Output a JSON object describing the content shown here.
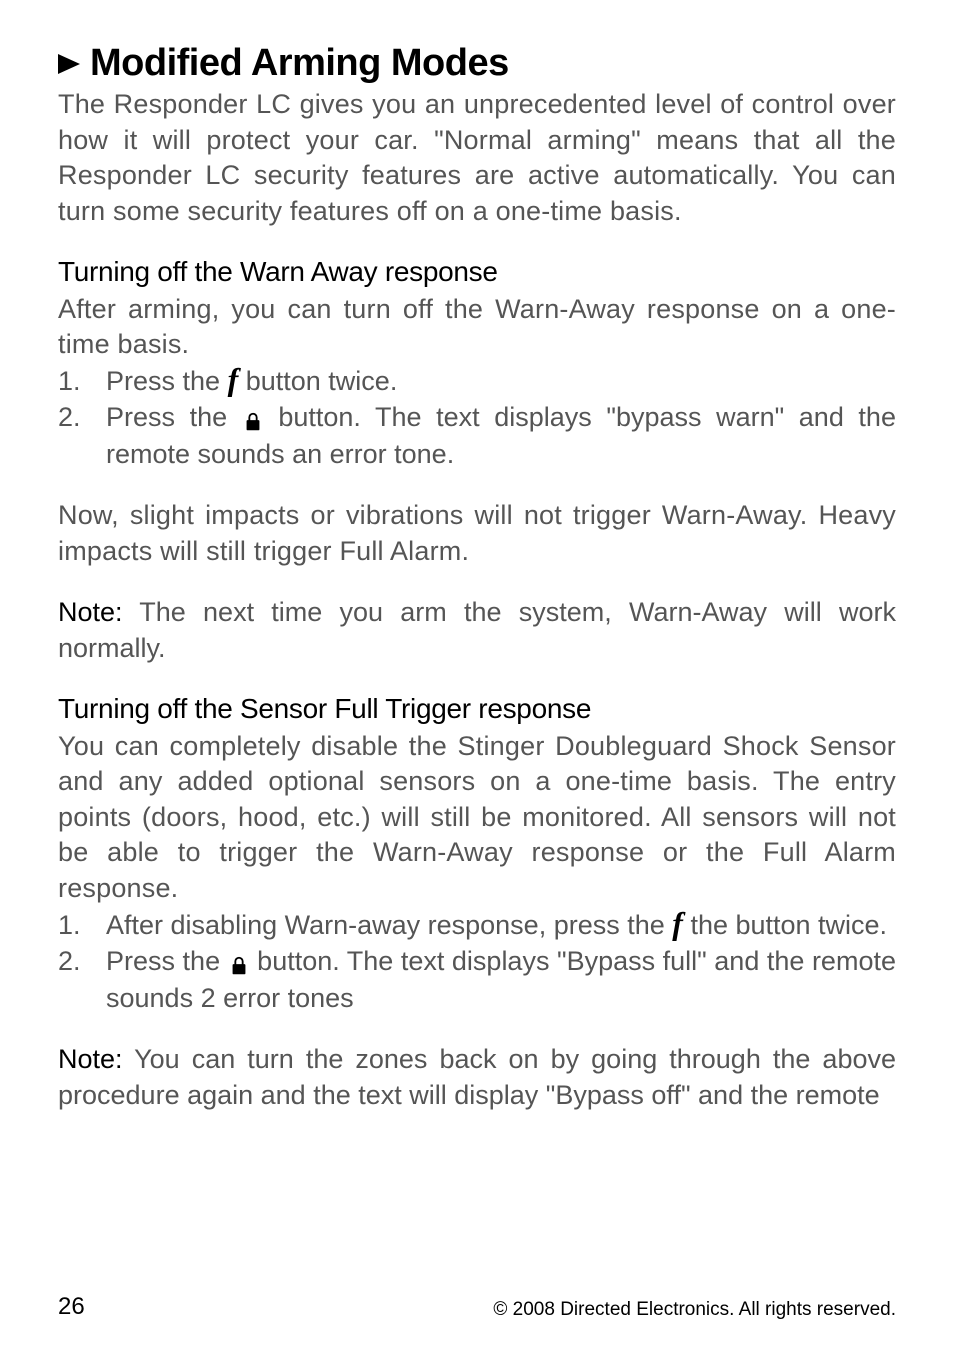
{
  "heading": "Modified Arming Modes",
  "intro": "The Responder LC gives you an unprecedented level of control over how it will protect your car. \"Normal arming\" means that all the Responder LC security features are active automatically. You can turn some security features off on a one-time basis.",
  "s1": {
    "title": "Turning off the Warn Away response",
    "lead": "After arming, you can turn off the Warn-Away response on a one-time basis.",
    "li1_num": "1.",
    "li1_a": "Press the ",
    "li1_b": " button twice.",
    "li2_num": "2.",
    "li2_a": "Press the ",
    "li2_b": " button. The text displays \"bypass warn\" and the remote sounds an error tone.",
    "after": "Now, slight impacts or vibrations will not trigger Warn-Away. Heavy impacts will still trigger Full Alarm.",
    "note_label": "Note:",
    "note": " The next time you arm the system, Warn-Away will work normally."
  },
  "s2": {
    "title": "Turning off the Sensor Full Trigger response",
    "lead": "You can completely disable the Stinger Doubleguard Shock Sensor and any added optional sensors on a one-time basis. The entry points (doors, hood, etc.) will still be monitored. All sensors will not be able to trigger the Warn-Away response or the Full Alarm response.",
    "li1_num": "1.",
    "li1_a": "After disabling Warn-away response, press the ",
    "li1_b": " the button twice.",
    "li2_num": "2.",
    "li2_a": "Press the ",
    "li2_b": " button. The text displays \"Bypass full\" and the remote sounds 2 error tones",
    "note_label": "Note:",
    "note": " You can turn the zones back on by going through the above procedure again and the text will display \"Bypass off\" and the remote"
  },
  "icon_f": "f",
  "footer": {
    "page": "26",
    "copy": "© 2008 Directed Electronics. All rights reserved."
  }
}
